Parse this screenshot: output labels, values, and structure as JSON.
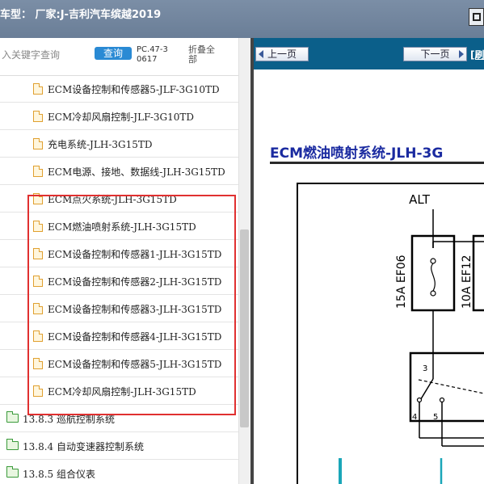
{
  "window": {
    "title": "车型：  厂家:J-吉利汽车缤越2019"
  },
  "search": {
    "placeholder": "入关键字查询",
    "query_label": "查询",
    "pc_code": "PC.47-30617",
    "fold_all_label": "折叠全部"
  },
  "tree": {
    "items": [
      {
        "label": "ECM设备控制和传感器5-JLF-3G10TD"
      },
      {
        "label": "ECM冷却风扇控制-JLF-3G10TD"
      },
      {
        "label": "充电系统-JLH-3G15TD"
      },
      {
        "label": "ECM电源、接地、数据线-JLH-3G15TD"
      },
      {
        "label": "ECM点火系统-JLH-3G15TD"
      },
      {
        "label": "ECM燃油喷射系统-JLH-3G15TD"
      },
      {
        "label": "ECM设备控制和传感器1-JLH-3G15TD"
      },
      {
        "label": "ECM设备控制和传感器2-JLH-3G15TD"
      },
      {
        "label": "ECM设备控制和传感器3-JLH-3G15TD"
      },
      {
        "label": "ECM设备控制和传感器4-JLH-3G15TD"
      },
      {
        "label": "ECM设备控制和传感器5-JLH-3G15TD"
      },
      {
        "label": "ECM冷却风扇控制-JLH-3G15TD"
      }
    ],
    "folders": [
      {
        "label": "13.8.3 巡航控制系统"
      },
      {
        "label": "13.8.4 自动变速器控制系统"
      },
      {
        "label": "13.8.5 组合仪表"
      }
    ]
  },
  "viewer": {
    "prev_label": "上一页",
    "next_label": "下一页",
    "refresh_label": "[刷",
    "doc_title": "ECM燃油喷射系统-JLH-3G",
    "diagram": {
      "source_label": "ALT",
      "fuse1_label": "15A EF06",
      "fuse2_label": "10A EF12",
      "pin3": "3",
      "pin4": "4",
      "pin5": "5"
    }
  },
  "colors": {
    "titlebar": "#6f839c",
    "nav_bar": "#0b5f8a",
    "query_button": "#2a8ad4",
    "highlight_border": "#e03030",
    "doc_title": "#1a2aa0",
    "folder_icon": "#3a9a3a",
    "doc_icon": "#e0a030"
  }
}
